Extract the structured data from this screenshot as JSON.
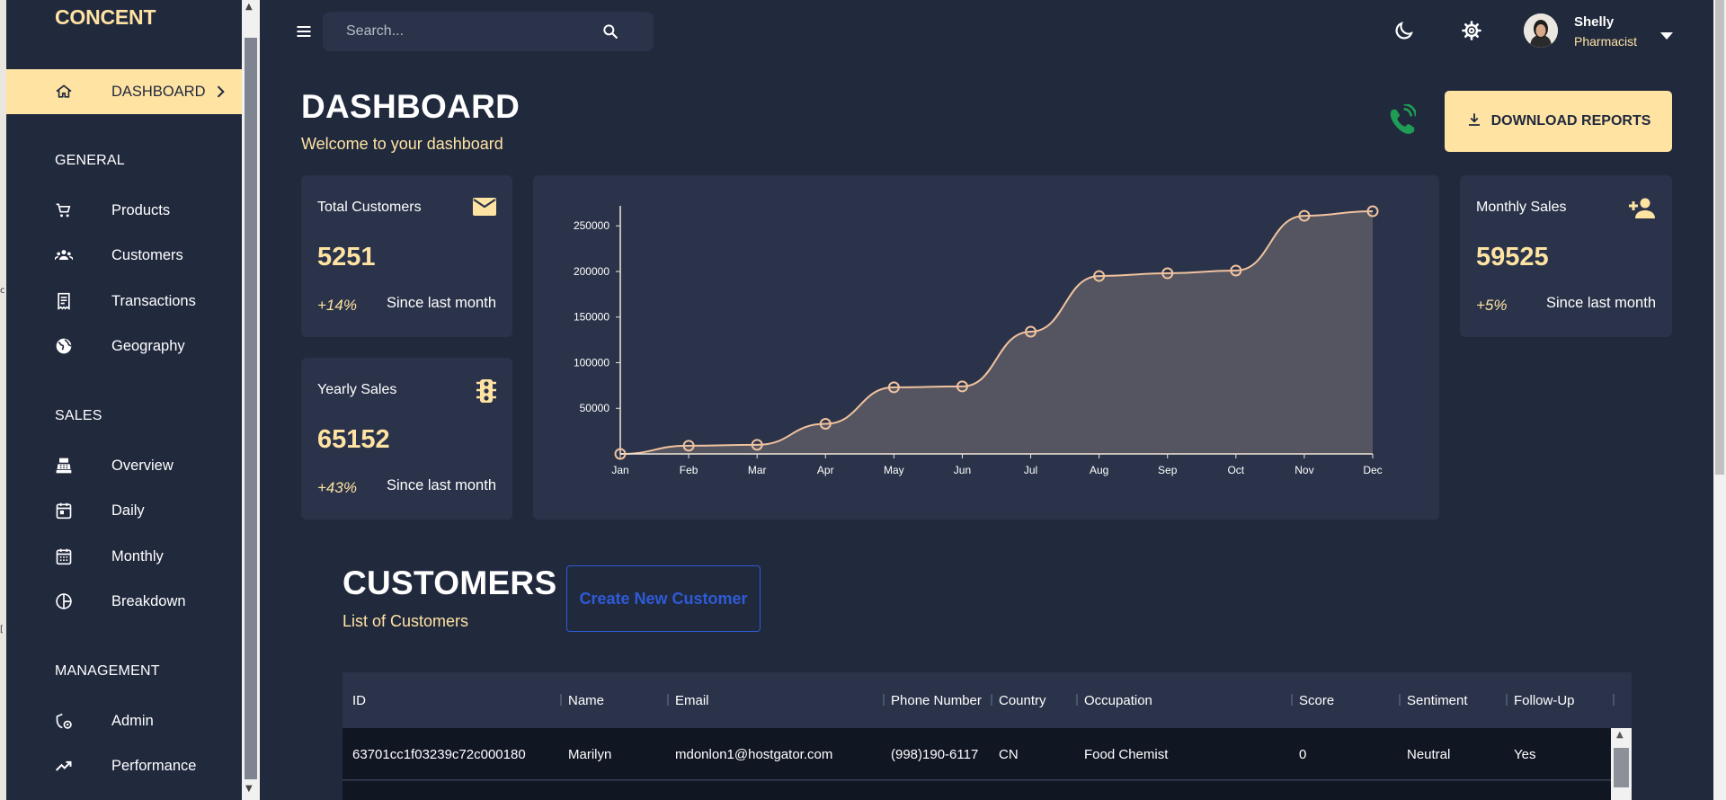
{
  "app": {
    "brand": "CONCENT"
  },
  "sidebar": {
    "active": {
      "label": "DASHBOARD",
      "icon": "home-icon"
    },
    "sections": [
      {
        "title": "GENERAL",
        "items": [
          {
            "label": "Products",
            "icon": "cart-icon"
          },
          {
            "label": "Customers",
            "icon": "groups-icon"
          },
          {
            "label": "Transactions",
            "icon": "receipt-icon"
          },
          {
            "label": "Geography",
            "icon": "globe-icon"
          }
        ]
      },
      {
        "title": "SALES",
        "items": [
          {
            "label": "Overview",
            "icon": "point-of-sale-icon"
          },
          {
            "label": "Daily",
            "icon": "calendar-today-icon"
          },
          {
            "label": "Monthly",
            "icon": "calendar-month-icon"
          },
          {
            "label": "Breakdown",
            "icon": "pie-chart-icon"
          }
        ]
      },
      {
        "title": "MANAGEMENT",
        "items": [
          {
            "label": "Admin",
            "icon": "admin-settings-icon"
          },
          {
            "label": "Performance",
            "icon": "trending-up-icon"
          }
        ]
      }
    ]
  },
  "topbar": {
    "search_placeholder": "Search...",
    "user": {
      "name": "Shelly",
      "role": "Pharmacist"
    },
    "icons": [
      "menu-icon",
      "search-icon",
      "dark-mode-icon",
      "settings-icon",
      "arrow-drop-down-icon"
    ]
  },
  "header": {
    "title": "DASHBOARD",
    "subtitle": "Welcome to your dashboard",
    "download_label": "DOWNLOAD REPORTS"
  },
  "stats": {
    "total_customers": {
      "title": "Total Customers",
      "value": "5251",
      "change": "+14%",
      "since": "Since last month",
      "icon": "email-icon"
    },
    "yearly_sales": {
      "title": "Yearly Sales",
      "value": "65152",
      "change": "+43%",
      "since": "Since last month",
      "icon": "traffic-icon"
    },
    "monthly_sales": {
      "title": "Monthly Sales",
      "value": "59525",
      "change": "+5%",
      "since": "Since last month",
      "icon": "person-add-icon"
    }
  },
  "chart_data": {
    "type": "area",
    "categories": [
      "Jan",
      "Feb",
      "Mar",
      "Apr",
      "May",
      "Jun",
      "Jul",
      "Aug",
      "Sep",
      "Oct",
      "Nov",
      "Dec"
    ],
    "values": [
      0,
      9000,
      10000,
      33000,
      73000,
      74000,
      134000,
      195000,
      198000,
      201000,
      261000,
      266000
    ],
    "yticks": [
      50000,
      100000,
      150000,
      200000,
      250000
    ],
    "ylim": [
      0,
      266000
    ],
    "grid": false,
    "colors": {
      "line": "#f0c29f",
      "fill": "#545560",
      "axis": "#f0e6d8"
    }
  },
  "customers": {
    "title": "CUSTOMERS",
    "subtitle": "List of Customers",
    "create_label": "Create New Customer",
    "columns": [
      "ID",
      "Name",
      "Email",
      "Phone Number",
      "Country",
      "Occupation",
      "Score",
      "Sentiment",
      "Follow-Up"
    ],
    "rows": [
      {
        "id": "63701cc1f03239c72c000180",
        "name": "Marilyn",
        "email": "mdonlon1@hostgator.com",
        "phone": "(998)190-6117",
        "country": "CN",
        "occupation": "Food Chemist",
        "score": "0",
        "sentiment": "Neutral",
        "followup": "Yes"
      }
    ]
  },
  "colors": {
    "background": "#21293d",
    "accent": "#ffe3a3",
    "card": "#2a3349",
    "link": "#2e5bd6",
    "phone": "#1f9d55"
  }
}
